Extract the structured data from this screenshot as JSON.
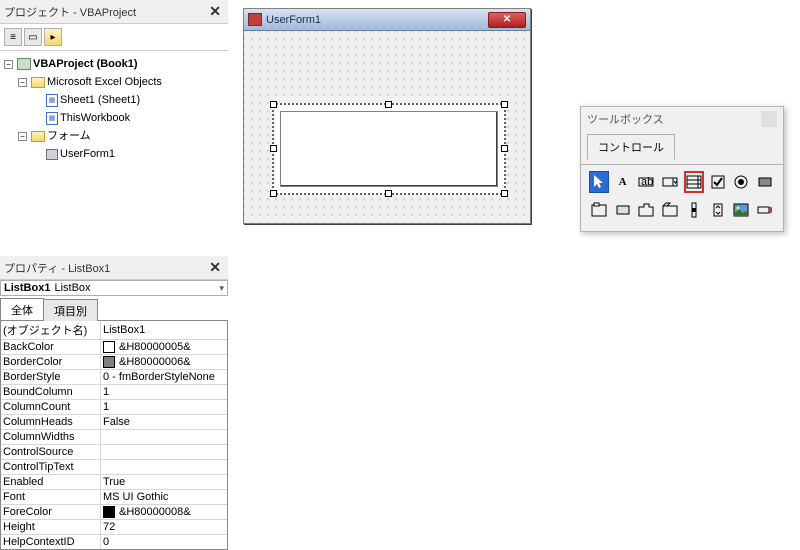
{
  "project_pane": {
    "title": "プロジェクト - VBAProject",
    "root": "VBAProject (Book1)",
    "excel_objects": "Microsoft Excel Objects",
    "sheet1": "Sheet1 (Sheet1)",
    "thiswb": "ThisWorkbook",
    "forms": "フォーム",
    "userform": "UserForm1"
  },
  "properties_pane": {
    "title": "プロパティ - ListBox1",
    "object_name": "ListBox1",
    "object_type": "ListBox",
    "tab_all": "全体",
    "tab_cat": "項目別",
    "rows": [
      {
        "name": "(オブジェクト名)",
        "value": "ListBox1"
      },
      {
        "name": "BackColor",
        "value": "&H80000005&",
        "swatch": "#ffffff"
      },
      {
        "name": "BorderColor",
        "value": "&H80000006&",
        "swatch": "#808080"
      },
      {
        "name": "BorderStyle",
        "value": "0 - fmBorderStyleNone"
      },
      {
        "name": "BoundColumn",
        "value": "1"
      },
      {
        "name": "ColumnCount",
        "value": "1"
      },
      {
        "name": "ColumnHeads",
        "value": "False"
      },
      {
        "name": "ColumnWidths",
        "value": ""
      },
      {
        "name": "ControlSource",
        "value": ""
      },
      {
        "name": "ControlTipText",
        "value": ""
      },
      {
        "name": "Enabled",
        "value": "True"
      },
      {
        "name": "Font",
        "value": "MS UI Gothic"
      },
      {
        "name": "ForeColor",
        "value": "&H80000008&",
        "swatch": "#000000"
      },
      {
        "name": "Height",
        "value": "72"
      },
      {
        "name": "HelpContextID",
        "value": "0"
      }
    ]
  },
  "form_designer": {
    "title": "UserForm1"
  },
  "toolbox": {
    "title": "ツールボックス",
    "tab": "コントロール",
    "controls_row1": [
      "pointer",
      "label",
      "textbox",
      "combobox",
      "listbox",
      "checkbox",
      "optionbutton",
      "togglebutton"
    ],
    "controls_row2": [
      "frame",
      "commandbutton",
      "tabstrip",
      "multipage",
      "scrollbar",
      "spinbutton",
      "image",
      "refedit"
    ],
    "selected": "pointer",
    "highlight": "listbox"
  }
}
